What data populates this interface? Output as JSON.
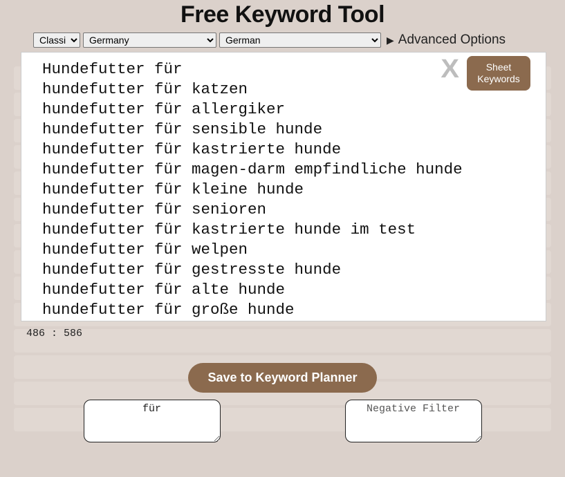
{
  "title": "Free Keyword Tool",
  "mode_selected": "Classic",
  "country_selected": "Germany",
  "language_selected": "German",
  "advanced_label": "Advanced Options",
  "close_label": "X",
  "sheet_button": "Sheet Keywords",
  "results": [
    "Hundefutter für",
    "hundefutter für katzen",
    "hundefutter für allergiker",
    "hundefutter für sensible hunde",
    "hundefutter für kastrierte hunde",
    "hundefutter für magen-darm empfindliche hunde",
    "hundefutter für kleine hunde",
    "hundefutter für senioren",
    "hundefutter für kastrierte hunde im test",
    "hundefutter für welpen",
    "hundefutter für gestresste hunde",
    "hundefutter für alte hunde",
    "hundefutter für große hunde"
  ],
  "counter": "486 : 586",
  "save_button": "Save to Keyword Planner",
  "positive_filter_value": "für",
  "negative_filter_placeholder": "Negative Filter"
}
